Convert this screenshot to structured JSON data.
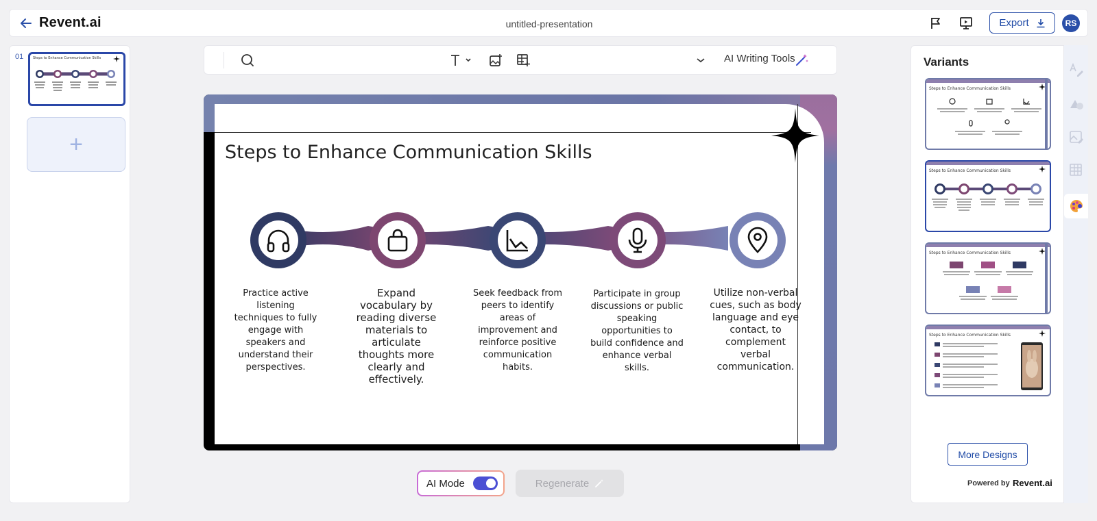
{
  "header": {
    "logo": "Revent.ai",
    "doc_title": "untitled-presentation",
    "export_label": "Export",
    "avatar_initials": "RS"
  },
  "left_panel": {
    "slide_number": "01",
    "add_slide_symbol": "+"
  },
  "toolbar": {
    "ai_writing_tools": "AI Writing Tools"
  },
  "slide": {
    "title": "Steps to Enhance Communication Skills",
    "steps": [
      {
        "icon": "headphones-icon",
        "text": "Practice active listening techniques to fully engage with speakers and understand their perspectives."
      },
      {
        "icon": "bag-icon",
        "text": "Expand vocabulary by reading diverse materials to articulate thoughts more clearly and effectively."
      },
      {
        "icon": "chart-icon",
        "text": "Seek feedback from peers to identify areas of improvement and reinforce positive communication habits."
      },
      {
        "icon": "microphone-icon",
        "text": "Participate in group discussions or public speaking opportunities to build confidence and enhance verbal skills."
      },
      {
        "icon": "location-pin-icon",
        "text": "Utilize non-verbal cues, such as body language and eye contact, to complement verbal communication."
      }
    ],
    "colors": {
      "c1": "#2f3a63",
      "c2": "#7d4670",
      "c3": "#3a4774",
      "c4": "#7d4a78",
      "c5": "#7882b5"
    }
  },
  "controls": {
    "ai_mode_label": "AI Mode",
    "ai_mode_on": true,
    "regenerate_label": "Regenerate"
  },
  "right_panel": {
    "title": "Variants",
    "variant_title": "Steps to Enhance Communication Skills",
    "more_designs": "More Designs",
    "powered_by": "Powered by",
    "powered_logo": "Revent.ai"
  }
}
